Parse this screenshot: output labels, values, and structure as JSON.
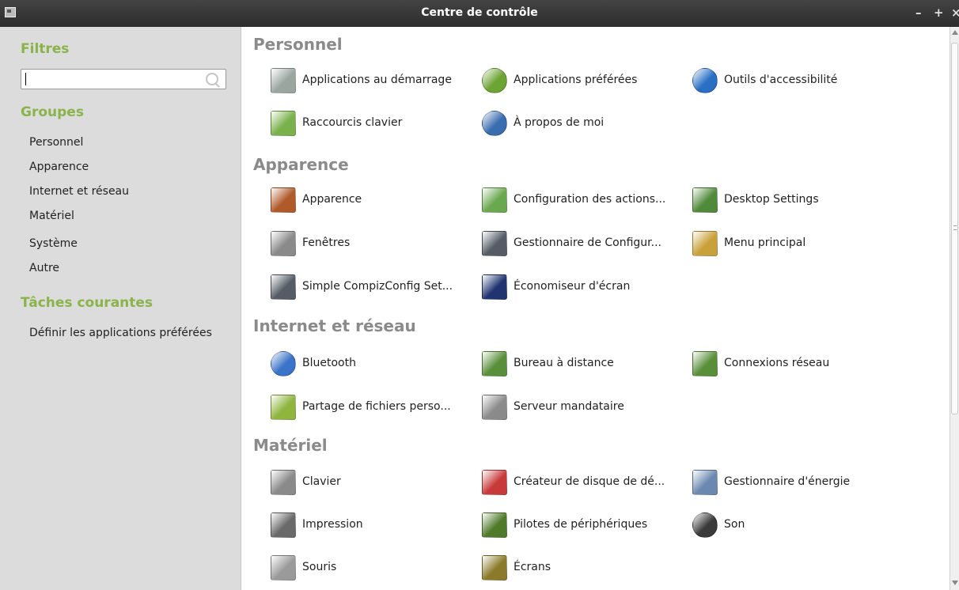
{
  "window": {
    "title": "Centre de contrôle",
    "controls": [
      "–",
      "+",
      "×"
    ]
  },
  "sidebar": {
    "filters_heading": "Filtres",
    "search": {
      "value": "",
      "placeholder": ""
    },
    "groups_heading": "Groupes",
    "groups": [
      "Personnel",
      "Apparence",
      "Internet et réseau",
      "Matériel",
      "Système",
      "Autre"
    ],
    "tasks_heading": "Tâches courantes",
    "tasks": [
      "Définir les applications préférées"
    ]
  },
  "sections": [
    {
      "title": "Personnel",
      "items": [
        {
          "label": "Applications au démarrage",
          "icon": "startup-apps-icon",
          "color": "#9aa5a0"
        },
        {
          "label": "Applications préférées",
          "icon": "checkmark-icon",
          "color": "#6da434"
        },
        {
          "label": "Outils d'accessibilité",
          "icon": "accessibility-icon",
          "color": "#2a6fc4"
        },
        {
          "label": "Raccourcis clavier",
          "icon": "keyboard-shortcuts-icon",
          "color": "#7ab14a"
        },
        {
          "label": "À propos de moi",
          "icon": "about-me-icon",
          "color": "#3a6db0"
        }
      ]
    },
    {
      "title": "Apparence",
      "items": [
        {
          "label": "Apparence",
          "icon": "appearance-icon",
          "color": "#b05a2a"
        },
        {
          "label": "Configuration des actions...",
          "icon": "actions-config-icon",
          "color": "#6aa84f"
        },
        {
          "label": "Desktop Settings",
          "icon": "desktop-settings-icon",
          "color": "#4f8a3a"
        },
        {
          "label": "Fenêtres",
          "icon": "windows-icon",
          "color": "#8a8a8a"
        },
        {
          "label": "Gestionnaire de Configur...",
          "icon": "config-manager-icon",
          "color": "#555c66"
        },
        {
          "label": "Menu principal",
          "icon": "main-menu-icon",
          "color": "#c9a13a"
        },
        {
          "label": "Simple CompizConfig Set...",
          "icon": "compizconfig-icon",
          "color": "#555c66"
        },
        {
          "label": "Économiseur d'écran",
          "icon": "screensaver-icon",
          "color": "#1f3470"
        }
      ]
    },
    {
      "title": "Internet et réseau",
      "items": [
        {
          "label": "Bluetooth",
          "icon": "bluetooth-icon",
          "color": "#3a74c8"
        },
        {
          "label": "Bureau à distance",
          "icon": "remote-desktop-icon",
          "color": "#5a8f3a"
        },
        {
          "label": "Connexions réseau",
          "icon": "network-connections-icon",
          "color": "#5a8f3a"
        },
        {
          "label": "Partage de fichiers perso...",
          "icon": "file-sharing-icon",
          "color": "#8fb53f"
        },
        {
          "label": "Serveur mandataire",
          "icon": "proxy-server-icon",
          "color": "#8a8a8a"
        }
      ]
    },
    {
      "title": "Matériel",
      "items": [
        {
          "label": "Clavier",
          "icon": "keyboard-icon",
          "color": "#8a8a8a"
        },
        {
          "label": "Créateur de disque de dé...",
          "icon": "disk-creator-icon",
          "color": "#c83a3a"
        },
        {
          "label": "Gestionnaire d'énergie",
          "icon": "power-manager-icon",
          "color": "#6a88b0"
        },
        {
          "label": "Impression",
          "icon": "printer-icon",
          "color": "#6a6a6a"
        },
        {
          "label": "Pilotes de périphériques",
          "icon": "device-drivers-icon",
          "color": "#4f7a2a"
        },
        {
          "label": "Son",
          "icon": "sound-icon",
          "color": "#3a3a3a"
        },
        {
          "label": "Souris",
          "icon": "mouse-icon",
          "color": "#9a9a9a"
        },
        {
          "label": "Écrans",
          "icon": "displays-icon",
          "color": "#8a7a2a"
        }
      ]
    }
  ]
}
